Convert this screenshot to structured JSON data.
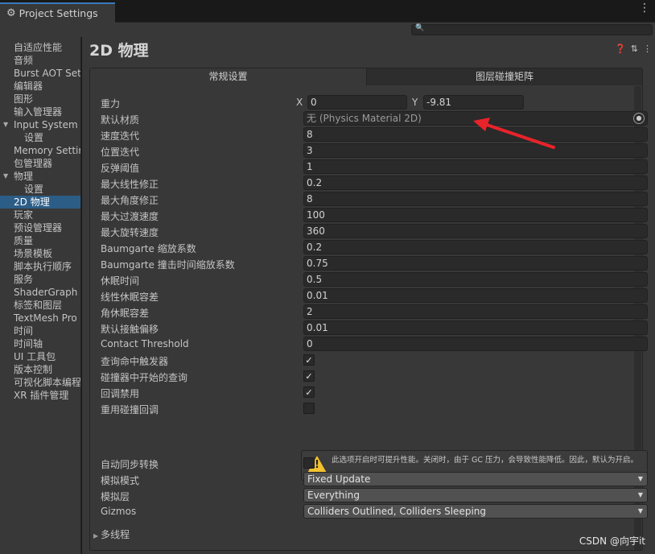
{
  "window": {
    "tab_title": "Project Settings"
  },
  "search": {
    "placeholder": ""
  },
  "sidebar": {
    "items": [
      {
        "label": "自适应性能"
      },
      {
        "label": "音频"
      },
      {
        "label": "Burst AOT Settings"
      },
      {
        "label": "编辑器"
      },
      {
        "label": "图形"
      },
      {
        "label": "输入管理器"
      },
      {
        "label": "Input System Package"
      },
      {
        "label": "设置"
      },
      {
        "label": "Memory Settings"
      },
      {
        "label": "包管理器"
      },
      {
        "label": "物理"
      },
      {
        "label": "设置"
      },
      {
        "label": "2D 物理"
      },
      {
        "label": "玩家"
      },
      {
        "label": "预设管理器"
      },
      {
        "label": "质量"
      },
      {
        "label": "场景模板"
      },
      {
        "label": "脚本执行顺序"
      },
      {
        "label": "服务"
      },
      {
        "label": "ShaderGraph"
      },
      {
        "label": "标签和图层"
      },
      {
        "label": "TextMesh Pro"
      },
      {
        "label": "时间"
      },
      {
        "label": "时间轴"
      },
      {
        "label": "UI 工具包"
      },
      {
        "label": "版本控制"
      },
      {
        "label": "可视化脚本编程"
      },
      {
        "label": "XR 插件管理"
      }
    ],
    "selected": "2D 物理"
  },
  "page": {
    "title": "2D 物理"
  },
  "tabs": {
    "general": "常规设置",
    "matrix": "图层碰撞矩阵"
  },
  "gravity": {
    "label": "重力",
    "x_label": "X",
    "x": "0",
    "y_label": "Y",
    "y": "-9.81"
  },
  "material": {
    "label": "默认材质",
    "value": "无 (Physics Material 2D)"
  },
  "fields": [
    {
      "label": "速度迭代",
      "value": "8"
    },
    {
      "label": "位置迭代",
      "value": "3"
    },
    {
      "label": "反弹阈值",
      "value": "1"
    },
    {
      "label": "最大线性修正",
      "value": "0.2"
    },
    {
      "label": "最大角度修正",
      "value": "8"
    },
    {
      "label": "最大过渡速度",
      "value": "100"
    },
    {
      "label": "最大旋转速度",
      "value": "360"
    },
    {
      "label": "Baumgarte 缩放系数",
      "value": "0.2"
    },
    {
      "label": "Baumgarte 撞击时间缩放系数",
      "value": "0.75"
    },
    {
      "label": "休眠时间",
      "value": "0.5"
    },
    {
      "label": "线性休眠容差",
      "value": "0.01"
    },
    {
      "label": "角休眠容差",
      "value": "2"
    },
    {
      "label": "默认接触偏移",
      "value": "0.01"
    },
    {
      "label": "Contact Threshold",
      "value": "0"
    }
  ],
  "checks": [
    {
      "label": "查询命中触发器",
      "mark": "✓"
    },
    {
      "label": "碰撞器中开始的查询",
      "mark": "✓"
    },
    {
      "label": "回调禁用",
      "mark": "✓"
    },
    {
      "label": "重用碰撞回调",
      "mark": ""
    }
  ],
  "help": {
    "text": "此选项开启时可提升性能。关闭时，由于 GC 压力，会导致性能降低。因此，默认为开启。",
    "icon": "!"
  },
  "auto_sync": {
    "label": "自动同步转换",
    "mark": ""
  },
  "dropdowns": [
    {
      "label": "模拟模式",
      "value": "Fixed Update"
    },
    {
      "label": "模拟层",
      "value": "Everything"
    },
    {
      "label": "Gizmos",
      "value": "Colliders Outlined, Colliders Sleeping"
    }
  ],
  "foldout": {
    "label": "多线程"
  },
  "watermark": "CSDN @向宇it",
  "colors": {
    "selection": "#2c5d87",
    "tab_accent": "#3a79bb",
    "arrow": "#e8232a",
    "warning": "#f2c230"
  }
}
